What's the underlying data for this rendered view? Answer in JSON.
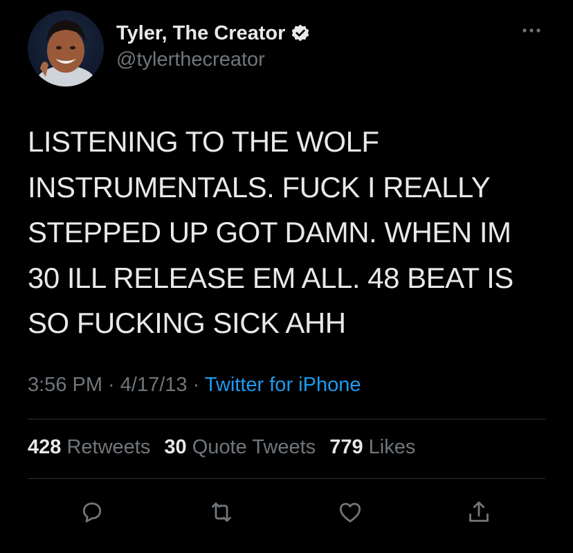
{
  "author": {
    "display_name": "Tyler, The Creator",
    "handle": "@tylerthecreator",
    "verified": true
  },
  "tweet": {
    "text_lines": [
      "LISTENING TO THE WOLF",
      "INSTRUMENTALS. FUCK I REALLY",
      "STEPPED UP GOT DAMN. WHEN IM",
      "30 ILL RELEASE EM ALL. 48 BEAT IS",
      "SO FUCKING SICK AHH"
    ],
    "time": "3:56 PM",
    "separator": " · ",
    "date": "4/17/13",
    "source": "Twitter for iPhone"
  },
  "stats": {
    "retweets_count": "428",
    "retweets_label": "Retweets",
    "quotes_count": "30",
    "quotes_label": "Quote Tweets",
    "likes_count": "779",
    "likes_label": "Likes"
  },
  "icons": {
    "more": "more-icon",
    "verified": "verified-badge-icon",
    "reply": "reply-icon",
    "retweet": "retweet-icon",
    "like": "like-icon",
    "share": "share-icon"
  },
  "colors": {
    "background": "#000000",
    "text": "#e7e9ea",
    "secondary": "#71767b",
    "link": "#1d9bf0",
    "divider": "#2f3336"
  }
}
